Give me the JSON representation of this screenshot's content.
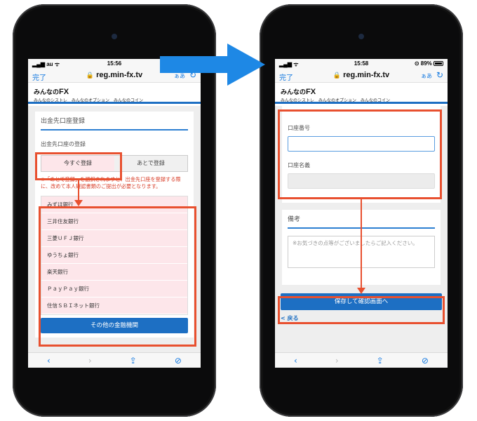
{
  "left": {
    "status": {
      "carrier": "au",
      "time": "15:56"
    },
    "browser": {
      "done": "完了",
      "url": "reg.min-fx.tv",
      "aa": "ぁあ"
    },
    "site": {
      "logo_pre": "みんなの",
      "logo_main": "FX",
      "logo_sub": "みんなのシストレ　みんなのオプション　みんなのコイン"
    },
    "form": {
      "title": "出金先口座登録",
      "label": "出金先口座の登録",
      "toggle_now": "今すぐ登録",
      "toggle_later": "あとで登録",
      "warning": "※「あとで登録」を選択されますと、出金先口座を登録する際に、改めて本人確認書類のご提出が必要となります。",
      "banks": [
        "みずほ銀行",
        "三井住友銀行",
        "三菱ＵＦＪ銀行",
        "ゆうちょ銀行",
        "楽天銀行",
        "ＰａｙＰａｙ銀行",
        "住信ＳＢＩネット銀行"
      ],
      "other_button": "その他の金融機関"
    }
  },
  "right": {
    "status": {
      "time": "15:58",
      "battery": "89%"
    },
    "browser": {
      "done": "完了",
      "url": "reg.min-fx.tv",
      "aa": "ぁあ"
    },
    "site": {
      "logo_pre": "みんなの",
      "logo_main": "FX",
      "logo_sub": "みんなのシストレ　みんなのオプション　みんなのコイン"
    },
    "form": {
      "account_number_label": "口座番号",
      "account_name_label": "口座名義",
      "notes_title": "備考",
      "notes_placeholder": "※お気づきの点等がございましたらご記入ください。",
      "save_button": "保存して確認画面へ",
      "back_link": "< 戻る"
    }
  },
  "colors": {
    "accent": "#1d6fc3",
    "highlight": "#e8502f",
    "pink": "#fde6ea",
    "arrow": "#1e88e5"
  }
}
